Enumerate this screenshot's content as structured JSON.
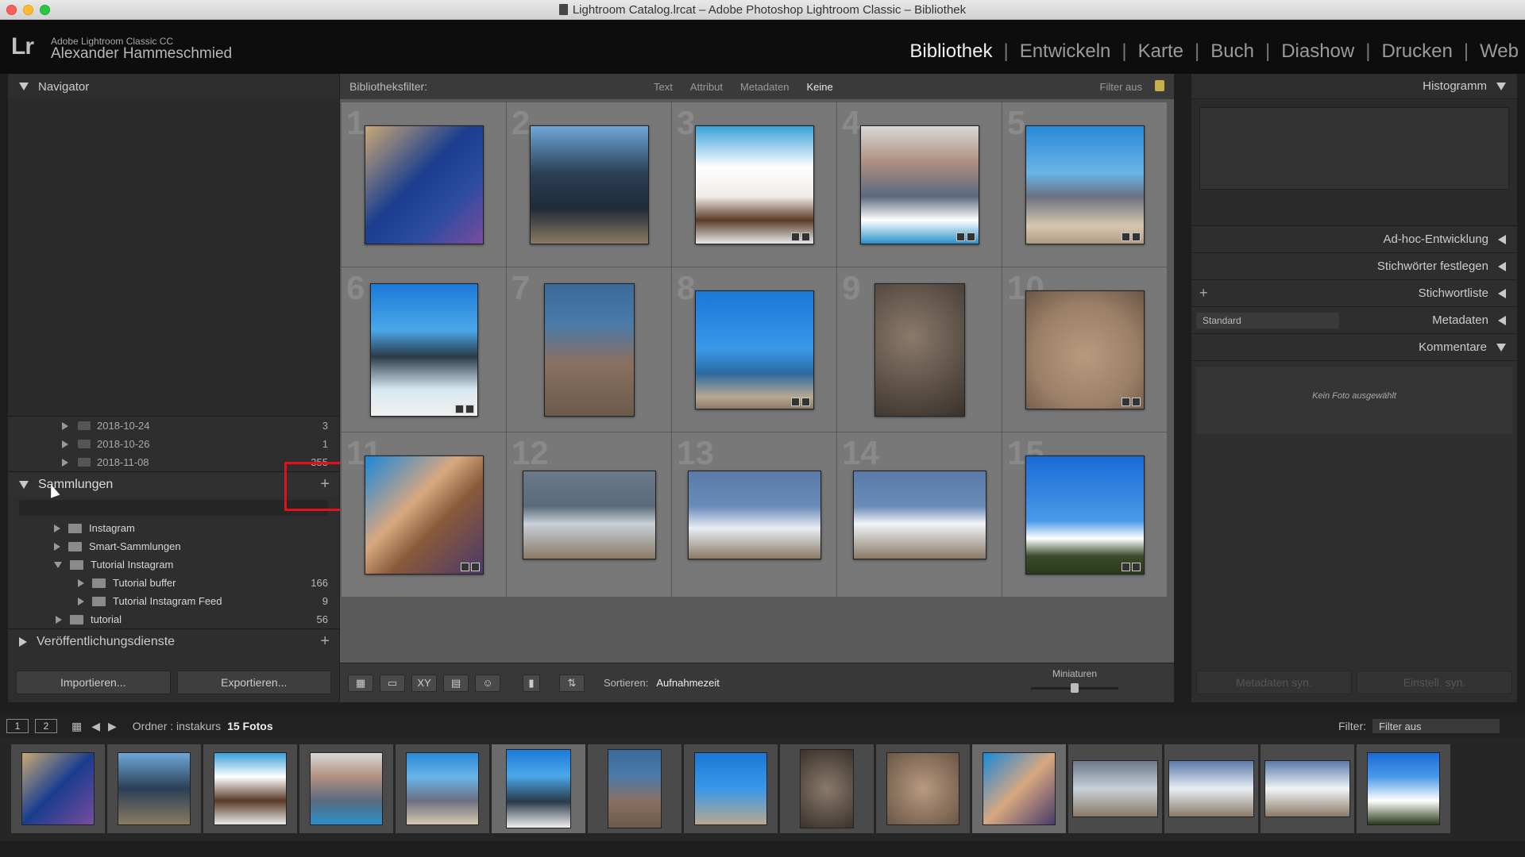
{
  "window": {
    "title": "Lightroom Catalog.lrcat – Adobe Photoshop Lightroom Classic – Bibliothek"
  },
  "identity": {
    "app": "Adobe Lightroom Classic CC",
    "user": "Alexander Hammeschmied",
    "logo": "Lr"
  },
  "modules": [
    "Bibliothek",
    "Entwickeln",
    "Karte",
    "Buch",
    "Diashow",
    "Drucken",
    "Web"
  ],
  "left": {
    "navigator": "Navigator",
    "folders": [
      {
        "name": "2018-10-24",
        "count": "3"
      },
      {
        "name": "2018-10-26",
        "count": "1"
      },
      {
        "name": "2018-11-08",
        "count": "355"
      }
    ],
    "collections_title": "Sammlungen",
    "collections": [
      {
        "name": "Instagram",
        "count": ""
      },
      {
        "name": "Smart-Sammlungen",
        "count": ""
      },
      {
        "name": "Tutorial Instagram",
        "count": ""
      },
      {
        "name": "Tutorial buffer",
        "count": "166"
      },
      {
        "name": "Tutorial Instagram Feed",
        "count": "9"
      },
      {
        "name": "tutorial",
        "count": "56"
      }
    ],
    "publish": "Veröffentlichungsdienste",
    "import": "Importieren...",
    "export": "Exportieren..."
  },
  "center": {
    "filter_label": "Bibliotheksfilter:",
    "filter_tabs": [
      "Text",
      "Attribut",
      "Metadaten",
      "Keine"
    ],
    "filter_off": "Filter aus",
    "numbers": [
      "1",
      "2",
      "3",
      "4",
      "5",
      "6",
      "7",
      "8",
      "9",
      "10",
      "11",
      "12",
      "13",
      "14",
      "15"
    ],
    "sort_label": "Sortieren:",
    "sort_value": "Aufnahmezeit",
    "mini_label": "Miniaturen"
  },
  "right": {
    "histogram": "Histogramm",
    "rows": [
      "Ad-hoc-Entwicklung",
      "Stichwörter festlegen",
      "Stichwortliste",
      "Metadaten",
      "Kommentare"
    ],
    "standard": "Standard",
    "no_photo": "Kein Foto ausgewählt",
    "sync_meta": "Metadaten syn.",
    "sync_settings": "Einstell. syn."
  },
  "filmstrip": {
    "page1": "1",
    "page2": "2",
    "source": "Ordner : instakurs",
    "count": "15 Fotos",
    "filter_label": "Filter:",
    "filter_value": "Filter aus"
  },
  "colors": {
    "highlight": "#e3101c",
    "accent": "#f0f0f0"
  }
}
